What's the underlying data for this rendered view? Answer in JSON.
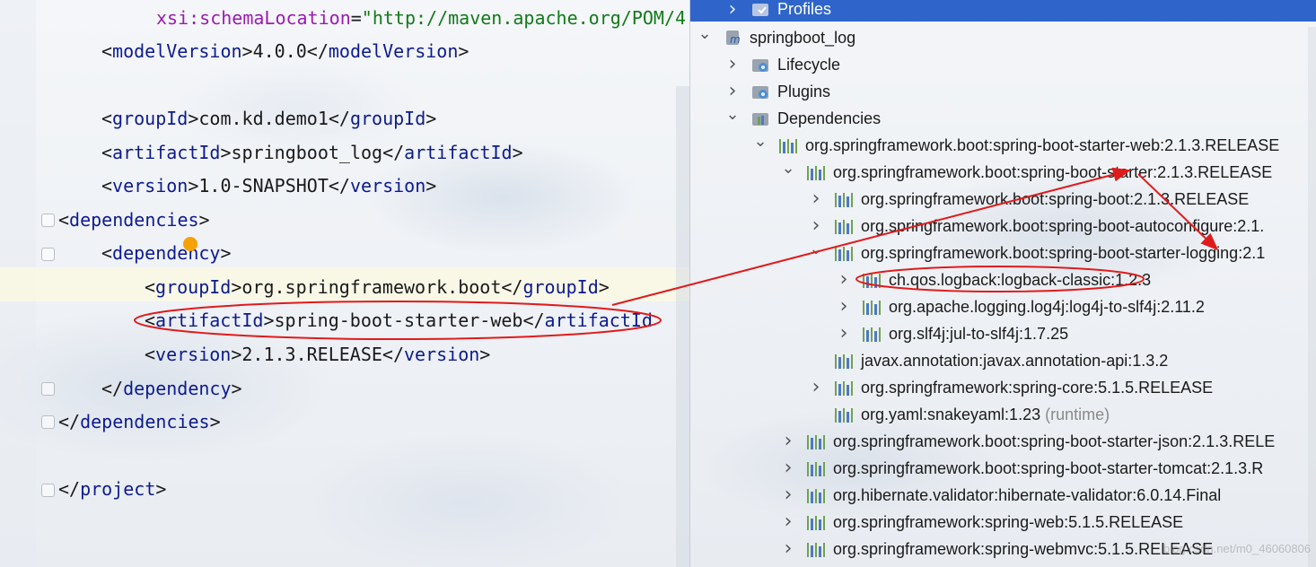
{
  "editor": {
    "lines": [
      {
        "parts": [
          [
            "attr",
            "xsi:schemaLocation"
          ],
          [
            "brk",
            "="
          ],
          [
            "str",
            "\"http://maven.apache.org/POM/4."
          ]
        ]
      },
      {
        "parts": [
          [
            "brk",
            "<"
          ],
          [
            "tag",
            "modelVersion"
          ],
          [
            "brk",
            ">4.0.0</"
          ],
          [
            "tag",
            "modelVersion"
          ],
          [
            "brk",
            ">"
          ]
        ]
      },
      {
        "parts": []
      },
      {
        "parts": [
          [
            "brk",
            "<"
          ],
          [
            "tag",
            "groupId"
          ],
          [
            "brk",
            ">com.kd.demo1</"
          ],
          [
            "tag",
            "groupId"
          ],
          [
            "brk",
            ">"
          ]
        ]
      },
      {
        "parts": [
          [
            "brk",
            "<"
          ],
          [
            "tag",
            "artifactId"
          ],
          [
            "brk",
            ">springboot_log</"
          ],
          [
            "tag",
            "artifactId"
          ],
          [
            "brk",
            ">"
          ]
        ]
      },
      {
        "parts": [
          [
            "brk",
            "<"
          ],
          [
            "tag",
            "version"
          ],
          [
            "brk",
            ">1.0-SNAPSHOT</"
          ],
          [
            "tag",
            "version"
          ],
          [
            "brk",
            ">"
          ]
        ]
      },
      {
        "parts": [
          [
            "brk",
            "<"
          ],
          [
            "tag",
            "dependencies"
          ],
          [
            "brk",
            ">"
          ]
        ]
      },
      {
        "parts": [
          [
            "brk",
            "<"
          ],
          [
            "tag",
            "dependency"
          ],
          [
            "brk",
            ">"
          ]
        ]
      },
      {
        "parts": [
          [
            "brk",
            "<"
          ],
          [
            "tag",
            "groupId"
          ],
          [
            "brk",
            ">org.springframework.boot</"
          ],
          [
            "tag",
            "groupId"
          ],
          [
            "brk",
            ">"
          ]
        ]
      },
      {
        "parts": [
          [
            "brk",
            "<"
          ],
          [
            "tag",
            "artifactId"
          ],
          [
            "brk",
            ">spring-boot-starter-web</"
          ],
          [
            "tag",
            "artifactId"
          ]
        ]
      },
      {
        "parts": [
          [
            "brk",
            "<"
          ],
          [
            "tag",
            "version"
          ],
          [
            "brk",
            ">2.1.3.RELEASE</"
          ],
          [
            "tag",
            "version"
          ],
          [
            "brk",
            ">"
          ]
        ]
      },
      {
        "parts": [
          [
            "brk",
            "</"
          ],
          [
            "tag",
            "dependency"
          ],
          [
            "brk",
            ">"
          ]
        ]
      },
      {
        "parts": [
          [
            "brk",
            "</"
          ],
          [
            "tag",
            "dependencies"
          ],
          [
            "brk",
            ">"
          ]
        ]
      },
      {
        "parts": []
      },
      {
        "parts": [
          [
            "brk",
            "</"
          ],
          [
            "tag",
            "project"
          ],
          [
            "brk",
            ">"
          ]
        ]
      }
    ]
  },
  "tree": {
    "rows": [
      {
        "label": "Profiles",
        "chevron": "right",
        "icon": "profiles-folder-icon",
        "selected": true
      },
      {
        "label": "springboot_log",
        "chevron": "down",
        "icon": "maven-module-icon"
      },
      {
        "label": "Lifecycle",
        "chevron": "right",
        "icon": "lifecycle-folder-icon"
      },
      {
        "label": "Plugins",
        "chevron": "right",
        "icon": "plugins-folder-icon"
      },
      {
        "label": "Dependencies",
        "chevron": "down",
        "icon": "dependencies-folder-icon"
      },
      {
        "label": "org.springframework.boot:spring-boot-starter-web:2.1.3.RELEASE",
        "chevron": "down",
        "icon": "library-icon"
      },
      {
        "label": "org.springframework.boot:spring-boot-starter:2.1.3.RELEASE",
        "chevron": "down",
        "icon": "library-icon"
      },
      {
        "label": "org.springframework.boot:spring-boot:2.1.3.RELEASE",
        "chevron": "right",
        "icon": "library-icon"
      },
      {
        "label": "org.springframework.boot:spring-boot-autoconfigure:2.1.",
        "chevron": "right",
        "icon": "library-icon"
      },
      {
        "label": "org.springframework.boot:spring-boot-starter-logging:2.1",
        "chevron": "down",
        "icon": "library-icon"
      },
      {
        "label": "ch.qos.logback:logback-classic:1.2.3",
        "chevron": "right",
        "icon": "library-icon"
      },
      {
        "label": "org.apache.logging.log4j:log4j-to-slf4j:2.11.2",
        "chevron": "right",
        "icon": "library-icon"
      },
      {
        "label": "org.slf4j:jul-to-slf4j:1.7.25",
        "chevron": "right",
        "icon": "library-icon"
      },
      {
        "label": "javax.annotation:javax.annotation-api:1.3.2",
        "chevron": "none",
        "icon": "library-icon"
      },
      {
        "label": "org.springframework:spring-core:5.1.5.RELEASE",
        "chevron": "right",
        "icon": "library-icon"
      },
      {
        "label": "org.yaml:snakeyaml:1.23",
        "suffix": "(runtime)",
        "chevron": "none",
        "icon": "library-icon"
      },
      {
        "label": "org.springframework.boot:spring-boot-starter-json:2.1.3.RELE",
        "chevron": "right",
        "icon": "library-icon"
      },
      {
        "label": "org.springframework.boot:spring-boot-starter-tomcat:2.1.3.R",
        "chevron": "right",
        "icon": "library-icon"
      },
      {
        "label": "org.hibernate.validator:hibernate-validator:6.0.14.Final",
        "chevron": "right",
        "icon": "library-icon"
      },
      {
        "label": "org.springframework:spring-web:5.1.5.RELEASE",
        "chevron": "right",
        "icon": "library-icon"
      },
      {
        "label": "org.springframework:spring-webmvc:5.1.5.RELEASE",
        "chevron": "right",
        "icon": "library-icon"
      }
    ]
  },
  "watermark": "blog.csdn.net/m0_46060806",
  "colors": {
    "selection": "#2f65ca",
    "annotation": "#e01b1b",
    "tag": "#0d1b8e",
    "attr": "#9b1bb0",
    "string": "#137a19"
  }
}
